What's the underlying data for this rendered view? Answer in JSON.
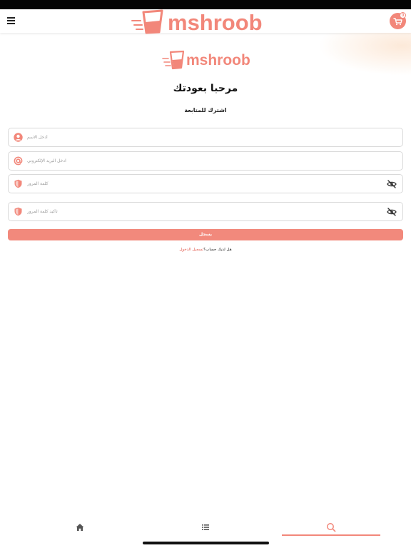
{
  "brand": {
    "name": "mshroob",
    "color": "#f2877a"
  },
  "header": {
    "menu_icon": "hamburger-menu-icon",
    "cart_icon": "shopping-cart-icon",
    "cart_count": "0"
  },
  "form": {
    "title": "مرحبا بعودتك",
    "subtitle": "اشترك للمتابعة",
    "fields": [
      {
        "icon": "user-icon",
        "placeholder": "أدخل الاسم",
        "value": ""
      },
      {
        "icon": "at-sign-icon",
        "placeholder": "ادخل البريد الإلكتروني",
        "value": ""
      },
      {
        "icon": "shield-icon",
        "placeholder": "كلمة المرور",
        "value": "",
        "trailing_icon": "eye-off-icon"
      },
      {
        "icon": "shield-icon",
        "placeholder": "تأكيد كلمة المرور",
        "value": "",
        "trailing_icon": "eye-off-icon"
      }
    ],
    "submit_label": "يسجل",
    "signin_question": "هل لديك حساب؟",
    "signin_link": "تسجيل الدخول"
  },
  "bottom_nav": {
    "items": [
      {
        "icon": "home-icon"
      },
      {
        "icon": "list-icon"
      },
      {
        "icon": "search-icon",
        "active": true
      }
    ]
  }
}
